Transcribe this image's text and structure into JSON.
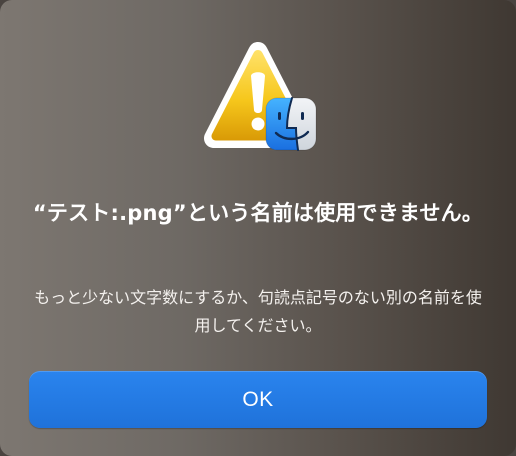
{
  "dialog": {
    "icon": "caution-triangle-with-finder-badge",
    "title": "“テスト:.png”という名前は使用できません。",
    "message": "もっと少ない文字数にするか、句読点記号のない別の名前を使用してください。",
    "ok_label": "OK"
  },
  "colors": {
    "button_blue": "#1f72da",
    "warning_yellow": "#f5c518",
    "finder_blue": "#1e8ff5"
  }
}
